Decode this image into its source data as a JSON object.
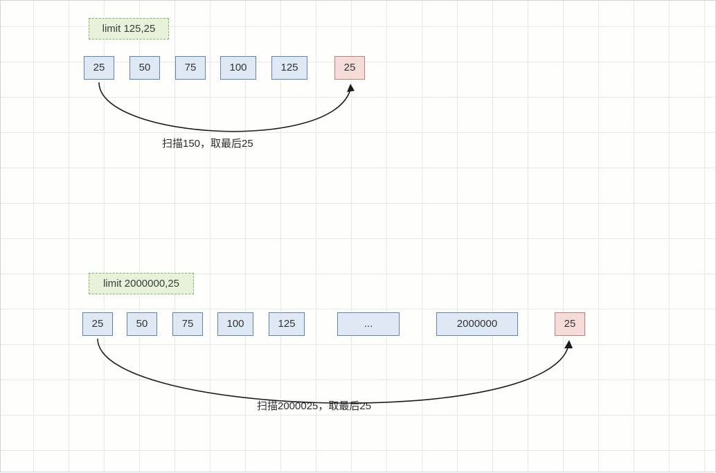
{
  "diagram1": {
    "limit_label": "limit 125,25",
    "blocks": [
      "25",
      "50",
      "75",
      "100",
      "125"
    ],
    "result": "25",
    "annotation": "扫描150，取最后25"
  },
  "diagram2": {
    "limit_label": "limit 2000000,25",
    "blocks": [
      "25",
      "50",
      "75",
      "100",
      "125",
      "...",
      "2000000"
    ],
    "result": "25",
    "annotation": "扫描2000025，取最后25"
  }
}
